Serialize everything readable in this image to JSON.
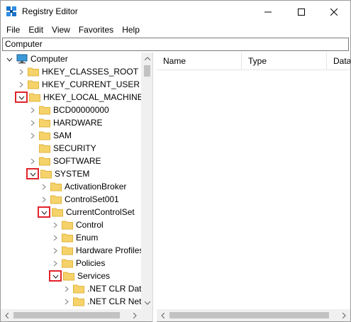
{
  "window": {
    "title": "Registry Editor",
    "controls": [
      "minimize",
      "maximize",
      "close"
    ]
  },
  "menu": {
    "items": [
      "File",
      "Edit",
      "View",
      "Favorites",
      "Help"
    ]
  },
  "address": {
    "value": "Computer"
  },
  "tree": {
    "items": [
      {
        "label": "Computer",
        "level": 0,
        "expander": "expanded-plain",
        "icon": "computer-icon",
        "highlighted": false
      },
      {
        "label": "HKEY_CLASSES_ROOT",
        "level": 1,
        "expander": "collapsed",
        "icon": "folder-icon",
        "highlighted": false
      },
      {
        "label": "HKEY_CURRENT_USER",
        "level": 1,
        "expander": "collapsed",
        "icon": "folder-icon",
        "highlighted": false
      },
      {
        "label": "HKEY_LOCAL_MACHINE",
        "level": 1,
        "expander": "expanded",
        "icon": "folder-icon",
        "highlighted": true
      },
      {
        "label": "BCD00000000",
        "level": 2,
        "expander": "collapsed",
        "icon": "folder-icon",
        "highlighted": false
      },
      {
        "label": "HARDWARE",
        "level": 2,
        "expander": "collapsed",
        "icon": "folder-icon",
        "highlighted": false
      },
      {
        "label": "SAM",
        "level": 2,
        "expander": "collapsed",
        "icon": "folder-icon",
        "highlighted": false
      },
      {
        "label": "SECURITY",
        "level": 2,
        "expander": "none",
        "icon": "folder-icon",
        "highlighted": false
      },
      {
        "label": "SOFTWARE",
        "level": 2,
        "expander": "collapsed",
        "icon": "folder-icon",
        "highlighted": false
      },
      {
        "label": "SYSTEM",
        "level": 2,
        "expander": "expanded",
        "icon": "folder-icon",
        "highlighted": true
      },
      {
        "label": "ActivationBroker",
        "level": 3,
        "expander": "collapsed",
        "icon": "folder-icon",
        "highlighted": false
      },
      {
        "label": "ControlSet001",
        "level": 3,
        "expander": "collapsed",
        "icon": "folder-icon",
        "highlighted": false
      },
      {
        "label": "CurrentControlSet",
        "level": 3,
        "expander": "expanded",
        "icon": "folder-icon",
        "highlighted": true
      },
      {
        "label": "Control",
        "level": 4,
        "expander": "collapsed",
        "icon": "folder-icon",
        "highlighted": false
      },
      {
        "label": "Enum",
        "level": 4,
        "expander": "collapsed",
        "icon": "folder-icon",
        "highlighted": false
      },
      {
        "label": "Hardware Profiles",
        "level": 4,
        "expander": "collapsed",
        "icon": "folder-icon",
        "highlighted": false
      },
      {
        "label": "Policies",
        "level": 4,
        "expander": "collapsed",
        "icon": "folder-icon",
        "highlighted": false
      },
      {
        "label": "Services",
        "level": 4,
        "expander": "expanded",
        "icon": "folder-icon",
        "highlighted": true
      },
      {
        "label": ".NET CLR Data",
        "level": 5,
        "expander": "collapsed",
        "icon": "folder-icon",
        "highlighted": false
      },
      {
        "label": ".NET CLR Netw",
        "level": 5,
        "expander": "collapsed",
        "icon": "folder-icon",
        "highlighted": false
      }
    ]
  },
  "list": {
    "columns": [
      "Name",
      "Type",
      "Data"
    ]
  },
  "colors": {
    "folder": "#f5d26a",
    "folder_dark": "#e2b43c",
    "highlight_box": "#e0242b",
    "app_icon": "#1a73c8"
  }
}
